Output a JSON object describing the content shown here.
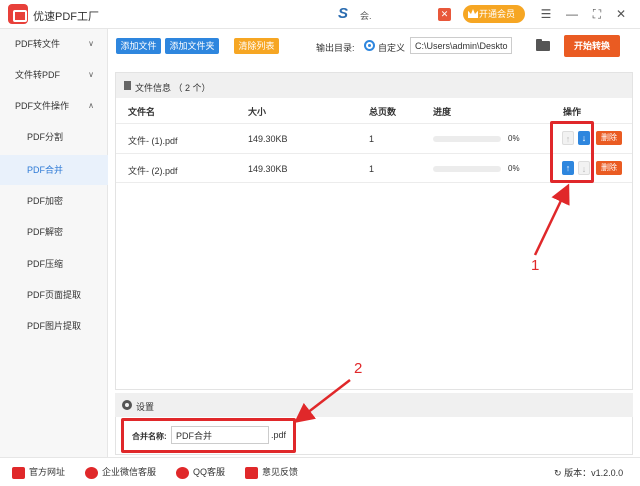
{
  "app": {
    "title": "优速PDF工厂",
    "user": "会.",
    "vip_label": "开通会员",
    "user_logo": "S"
  },
  "sidebar": {
    "groups": [
      {
        "label": "PDF转文件",
        "chevron": "∨"
      },
      {
        "label": "文件转PDF",
        "chevron": "∨"
      },
      {
        "label": "PDF文件操作",
        "chevron": "∧"
      }
    ],
    "subitems": [
      "PDF分割",
      "PDF合并",
      "PDF加密",
      "PDF解密",
      "PDF压缩",
      "PDF页面提取",
      "PDF图片提取"
    ],
    "active": "PDF合并"
  },
  "toolbar": {
    "add_file": "添加文件",
    "add_folder": "添加文件夹",
    "clear_list": "清除列表",
    "output_label": "输出目录:",
    "custom_label": "自定义",
    "output_path": "C:\\Users\\admin\\Deskto",
    "start_label": "开始转换"
  },
  "file_info": {
    "title": "文件信息 （ 2 个）",
    "columns": {
      "name": "文件名",
      "size": "大小",
      "pages": "总页数",
      "progress": "进度",
      "actions": "操作"
    },
    "rows": [
      {
        "name": "文件- (1).pdf",
        "size": "149.30KB",
        "pages": "1",
        "progress": 0,
        "pct": "0%",
        "delete": "删除"
      },
      {
        "name": "文件- (2).pdf",
        "size": "149.30KB",
        "pages": "1",
        "progress": 0,
        "pct": "0%",
        "delete": "删除"
      }
    ]
  },
  "settings": {
    "title": "设置",
    "merge_label": "合并名称:",
    "merge_value": "PDF合并",
    "merge_suffix": ".pdf"
  },
  "annotations": {
    "one": "1",
    "two": "2",
    "color": "#e0282a"
  },
  "footer": {
    "website": "官方网址",
    "wechat": "企业微信客服",
    "qq": "QQ客服",
    "feedback": "意见反馈",
    "version": "版本：v1.2.0.0"
  },
  "colors": {
    "accent_blue": "#2e86de",
    "accent_orange": "#ea5b22",
    "vip_orange": "#f6a623"
  }
}
